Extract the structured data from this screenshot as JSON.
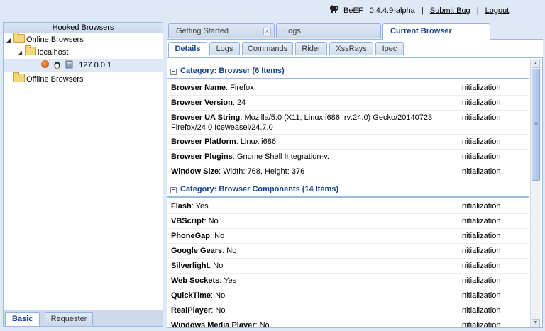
{
  "header": {
    "app_name": "BeEF",
    "version": "0.4.4.9-alpha",
    "separator": "|",
    "submit_bug": "Submit  Bug",
    "logout": "Logout"
  },
  "left_panel": {
    "title": "Hooked Browsers",
    "tree": {
      "online": "Online Browsers",
      "host": "localhost",
      "ip": "127.0.0.1",
      "offline": "Offline Browsers"
    },
    "tabs": [
      "Basic",
      "Requester"
    ]
  },
  "main_tabs": [
    "Getting Started",
    "Logs",
    "Current Browser"
  ],
  "sub_tabs": [
    "Details",
    "Logs",
    "Commands",
    "Rider",
    "XssRays",
    "Ipec"
  ],
  "details": {
    "groups": [
      {
        "title": "Category: Browser (6 Items)",
        "rows": [
          {
            "key": "Browser Name",
            "value": ": Firefox",
            "from": "Initialization"
          },
          {
            "key": "Browser Version",
            "value": ": 24",
            "from": "Initialization"
          },
          {
            "key": "Browser UA String",
            "value": ": Mozilla/5.0 (X11; Linux i686; rv:24.0) Gecko/20140723",
            "value2": "Firefox/24.0 Iceweasel/24.7.0",
            "from": "Initialization"
          },
          {
            "key": "Browser Platform",
            "value": ": Linux i686",
            "from": "Initialization"
          },
          {
            "key": "Browser Plugins",
            "value": ": Gnome Shell Integration-v.",
            "from": "Initialization"
          },
          {
            "key": "Window Size",
            "value": ": Width: 768, Height: 376",
            "from": "Initialization"
          }
        ]
      },
      {
        "title": "Category: Browser Components (14 Items)",
        "rows": [
          {
            "key": "Flash",
            "value": ": Yes",
            "from": "Initialization"
          },
          {
            "key": "VBScript",
            "value": ": No",
            "from": "Initialization"
          },
          {
            "key": "PhoneGap",
            "value": ": No",
            "from": "Initialization"
          },
          {
            "key": "Google Gears",
            "value": ": No",
            "from": "Initialization"
          },
          {
            "key": "Silverlight",
            "value": ": No",
            "from": "Initialization"
          },
          {
            "key": "Web Sockets",
            "value": ": Yes",
            "from": "Initialization"
          },
          {
            "key": "QuickTime",
            "value": ": No",
            "from": "Initialization"
          },
          {
            "key": "RealPlayer",
            "value": ": No",
            "from": "Initialization"
          },
          {
            "key": "Windows Media Player",
            "value": ": No",
            "from": "Initialization"
          }
        ]
      }
    ]
  },
  "icons": {
    "beef": "cow-icon",
    "firefox": "firefox-icon",
    "linux": "tux-icon",
    "host": "computer-icon"
  }
}
